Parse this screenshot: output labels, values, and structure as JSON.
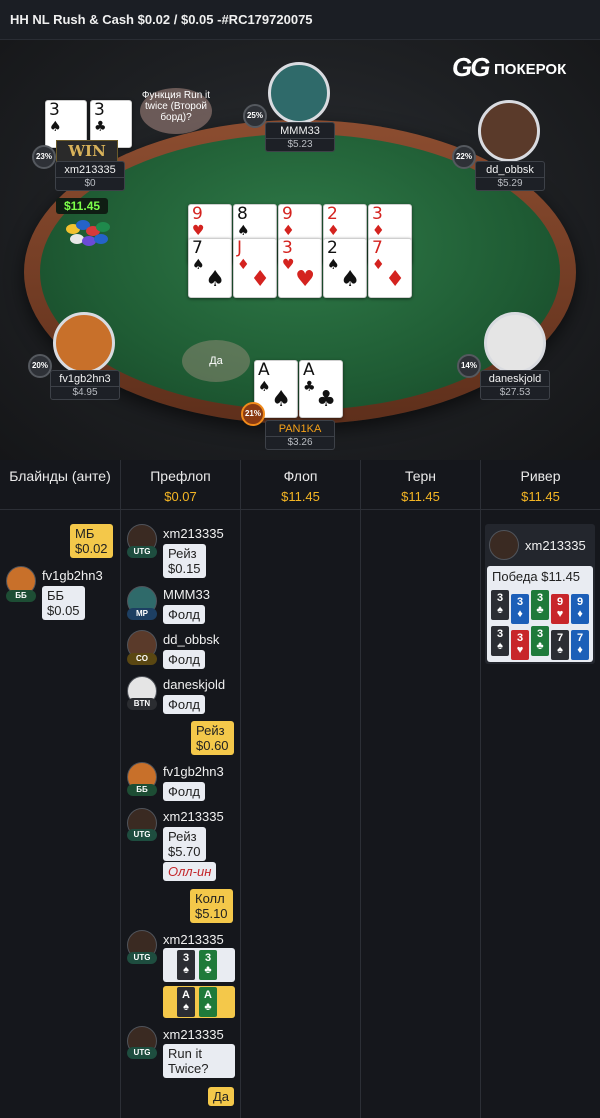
{
  "header": {
    "title": "HH NL Rush & Cash $0.02 / $0.05 -#RC179720075"
  },
  "logo": {
    "gg": "GG",
    "brand": "ПОКЕРОК"
  },
  "table": {
    "pot": "$11.45",
    "win_label": "WIN",
    "rit_bubble": "Функция Run it twice (Второй борд)?",
    "da_bubble": "Да",
    "dealer": "D",
    "board": [
      [
        {
          "r": "9",
          "s": "♥",
          "c": "red"
        },
        {
          "r": "8",
          "s": "♠",
          "c": "blk"
        },
        {
          "r": "9",
          "s": "♦",
          "c": "red"
        },
        {
          "r": "2",
          "s": "♦",
          "c": "red"
        },
        {
          "r": "3",
          "s": "♦",
          "c": "red"
        }
      ],
      [
        {
          "r": "7",
          "s": "♠",
          "c": "blk"
        },
        {
          "r": "J",
          "s": "♦",
          "c": "red"
        },
        {
          "r": "3",
          "s": "♥",
          "c": "red"
        },
        {
          "r": "2",
          "s": "♠",
          "c": "blk"
        },
        {
          "r": "7",
          "s": "♦",
          "c": "red"
        }
      ]
    ],
    "players": [
      {
        "name": "xm213335",
        "stack": "$0",
        "equity": "23%",
        "cards": [
          {
            "r": "3",
            "s": "♠"
          },
          {
            "r": "3",
            "s": "♣"
          }
        ]
      },
      {
        "name": "MMM33",
        "stack": "$5.23",
        "equity": "25%"
      },
      {
        "name": "dd_obbsk",
        "stack": "$5.29",
        "equity": "22%"
      },
      {
        "name": "fv1gb2hn3",
        "stack": "$4.95",
        "equity": "20%"
      },
      {
        "name": "daneskjold",
        "stack": "$27.53",
        "equity": "14%"
      },
      {
        "name": "PAN1KA",
        "stack": "$3.26",
        "equity": "21%",
        "cards": [
          {
            "r": "A",
            "s": "♠"
          },
          {
            "r": "A",
            "s": "♣"
          }
        ]
      }
    ]
  },
  "history": {
    "columns": [
      {
        "title": "Блайнды (анте)",
        "pot": ""
      },
      {
        "title": "Префлоп",
        "pot": "$0.07"
      },
      {
        "title": "Флоп",
        "pot": "$11.45"
      },
      {
        "title": "Терн",
        "pot": "$11.45"
      },
      {
        "title": "Ривер",
        "pot": "$11.45"
      }
    ],
    "blinds": {
      "sb_label": "МБ",
      "sb_amount": "$0.02",
      "bb_player": "fv1gb2hn3",
      "bb_pos": "ББ",
      "bb_label": "ББ",
      "bb_amount": "$0.05"
    },
    "preflop": [
      {
        "player": "xm213335",
        "pos": "UTG",
        "action": "Рейз",
        "amount": "$0.15"
      },
      {
        "player": "MMM33",
        "pos": "MP",
        "action": "Фолд"
      },
      {
        "player": "dd_obbsk",
        "pos": "CO",
        "action": "Фолд"
      },
      {
        "player": "daneskjold",
        "pos": "BTN",
        "action": "Фолд"
      },
      {
        "hero_action": "Рейз",
        "hero_amount": "$0.60"
      },
      {
        "player": "fv1gb2hn3",
        "pos": "ББ",
        "action": "Фолд"
      },
      {
        "player": "xm213335",
        "pos": "UTG",
        "action": "Рейз",
        "amount": "$5.70",
        "allin": "Олл-ин"
      },
      {
        "hero_action": "Колл",
        "hero_amount": "$5.10"
      },
      {
        "player": "xm213335",
        "pos": "UTG",
        "cards": [
          {
            "r": "3",
            "s": "♠"
          },
          {
            "r": "3",
            "s": "♣"
          }
        ]
      },
      {
        "hero_cards": [
          {
            "r": "A",
            "s": "♠"
          },
          {
            "r": "A",
            "s": "♣"
          }
        ]
      },
      {
        "player": "xm213335",
        "pos": "UTG",
        "action": "Run it Twice?"
      },
      {
        "hero_answer": "Да"
      }
    ],
    "river": {
      "player": "xm213335",
      "result": "Победа $11.45",
      "row1": [
        {
          "r": "3",
          "s": "♠"
        },
        {
          "r": "3",
          "s": "♦"
        },
        {
          "r": "3",
          "s": "♣"
        },
        {
          "r": "9",
          "s": "♥"
        },
        {
          "r": "9",
          "s": "♦"
        }
      ],
      "row2": [
        {
          "r": "3",
          "s": "♠"
        },
        {
          "r": "3",
          "s": "♥"
        },
        {
          "r": "3",
          "s": "♣"
        },
        {
          "r": "7",
          "s": "♠"
        },
        {
          "r": "7",
          "s": "♦"
        }
      ]
    }
  }
}
